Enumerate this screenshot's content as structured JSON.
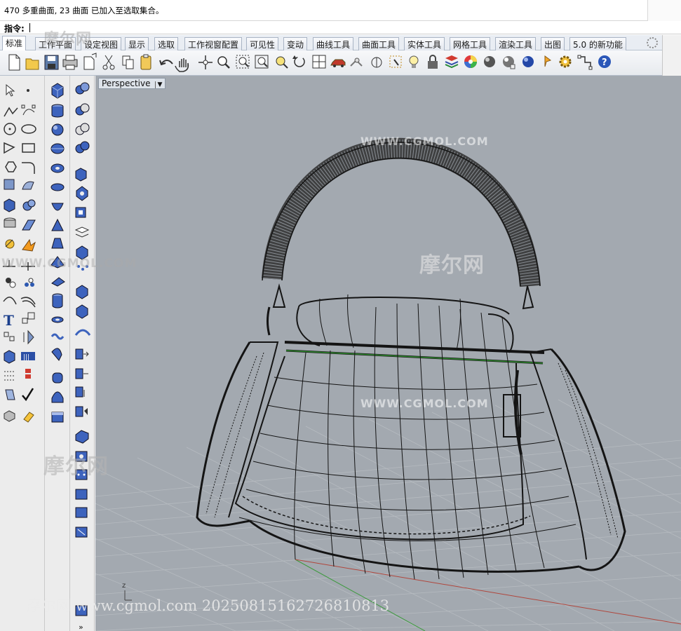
{
  "history": {
    "message": "470 多重曲面, 23 曲面 已加入至选取集合。"
  },
  "command": {
    "label": "指令:"
  },
  "tabs": [
    {
      "label": "标准"
    },
    {
      "label": "工作平面"
    },
    {
      "label": "设定视图"
    },
    {
      "label": "显示"
    },
    {
      "label": "选取"
    },
    {
      "label": "工作视窗配置"
    },
    {
      "label": "可见性"
    },
    {
      "label": "变动"
    },
    {
      "label": "曲线工具"
    },
    {
      "label": "曲面工具"
    },
    {
      "label": "实体工具"
    },
    {
      "label": "网格工具"
    },
    {
      "label": "渲染工具"
    },
    {
      "label": "出图"
    },
    {
      "label": "5.0 的新功能"
    }
  ],
  "toolbar": {
    "icons": [
      "new-icon",
      "open-icon",
      "save-icon",
      "print-icon",
      "import-icon",
      "cut-icon",
      "copy-icon",
      "paste-icon",
      "undo-icon",
      "pan-hand-icon",
      "move-view-icon",
      "zoom-icon",
      "zoom-window-icon",
      "zoom-extents-icon",
      "zoom-selected-icon",
      "rotate-view-icon",
      "four-viewports-icon",
      "car-icon",
      "walk-icon",
      "point-on-icon",
      "select-all-icon",
      "light-icon",
      "lock-icon",
      "layer-icon",
      "color-wheel-icon",
      "sphere-shaded-icon",
      "sphere-render-icon",
      "sphere-blue-icon",
      "options-icon",
      "gear-icon",
      "snap-icon",
      "help-icon"
    ]
  },
  "viewport": {
    "title": "Perspective",
    "axis_label": "z"
  },
  "watermarks": {
    "brand": "摩尔网",
    "site": "WWW.CGMOL.COM",
    "footer": "摩尔网 www.cgmol.com 20250815162726810813"
  },
  "colors": {
    "viewport_bg": "#a3a9b0",
    "wire": "#141414",
    "grid": "#b8bdc2",
    "x_axis": "#b0463c",
    "y_axis": "#3c9a3c"
  }
}
